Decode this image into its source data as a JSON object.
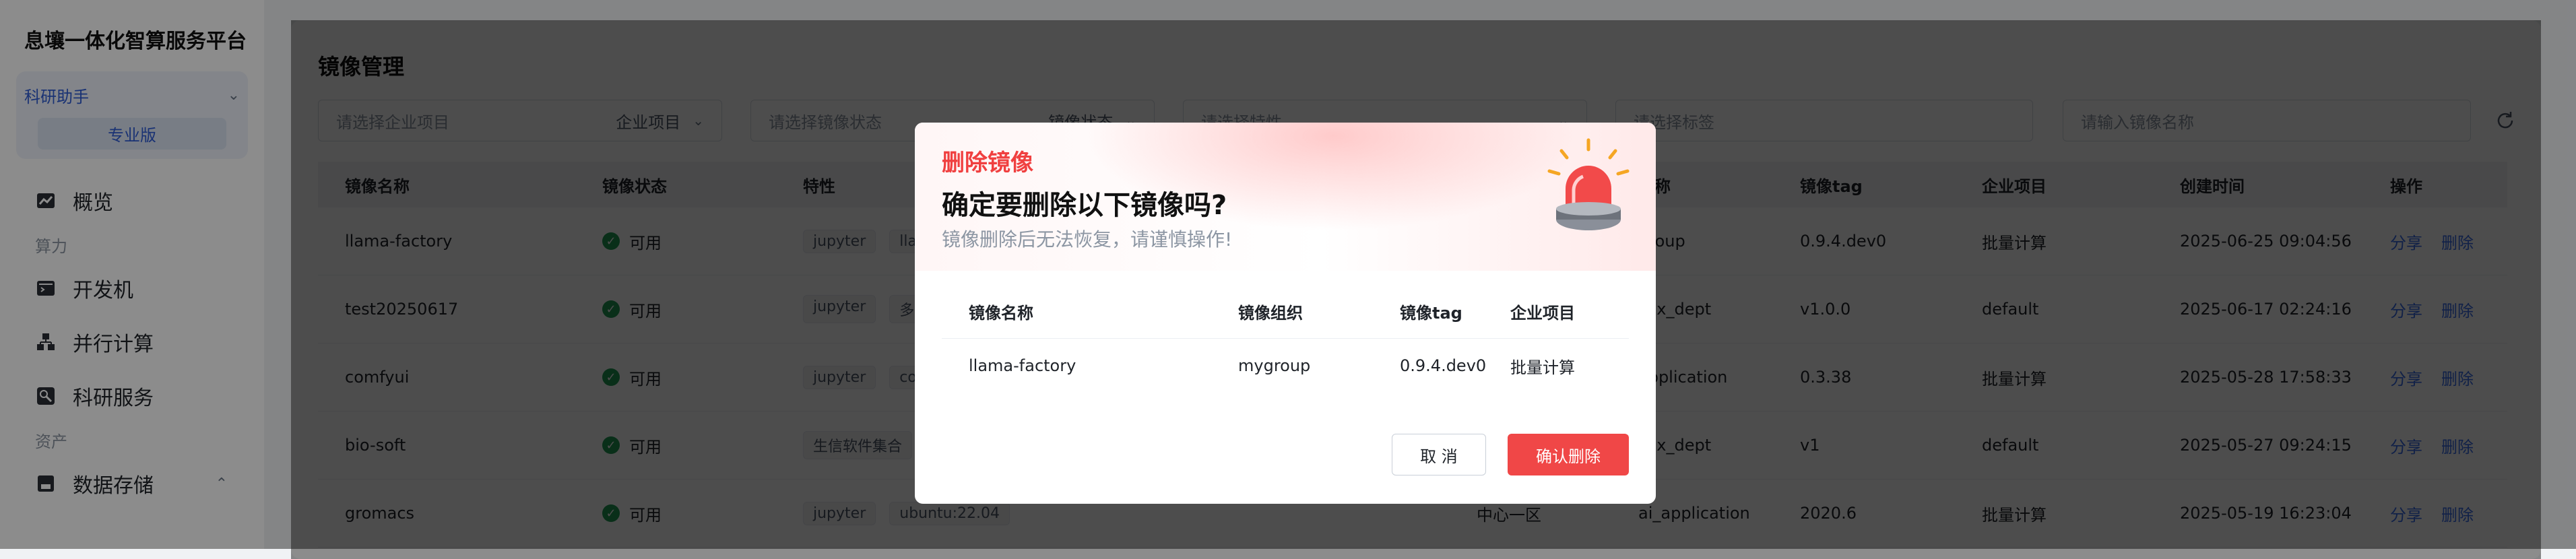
{
  "app_title": "息壤一体化智算服务平台",
  "workspace": {
    "name": "科研助手",
    "badge": "专业版"
  },
  "nav": {
    "overview": "概览",
    "section_compute": "算力",
    "dev_machine": "开发机",
    "parallel": "并行计算",
    "research": "科研服务",
    "section_assets": "资产",
    "storage": "数据存储"
  },
  "page": {
    "title": "镜像管理"
  },
  "filters": {
    "project_placeholder": "请选择企业项目",
    "project_tag": "企业项目",
    "status_placeholder": "请选择镜像状态",
    "status_tag": "镜像状态",
    "feature_placeholder": "请选择特性",
    "label_placeholder": "请选择标签",
    "name_placeholder": "请输入镜像名称"
  },
  "table": {
    "headers": [
      "镜像名称",
      "镜像状态",
      "特性",
      "",
      "名称",
      "镜像tag",
      "企业项目",
      "创建时间",
      "操作"
    ],
    "rows": [
      {
        "name": "llama-factory",
        "status": "可用",
        "chips": [
          "jupyter",
          "llam"
        ],
        "region": "",
        "org": "group",
        "tag": "0.9.4.dev0",
        "project": "批量计算",
        "created": "2025-06-25 09:04:56"
      },
      {
        "name": "test20250617",
        "status": "可用",
        "chips": [
          "jupyter",
          "多"
        ],
        "region": "",
        "org": "esx_dept",
        "tag": "v1.0.0",
        "project": "default",
        "created": "2025-06-17 02:24:16"
      },
      {
        "name": "comfyui",
        "status": "可用",
        "chips": [
          "jupyter",
          "co"
        ],
        "region": "",
        "org": "application",
        "tag": "0.3.38",
        "project": "批量计算",
        "created": "2025-05-28 17:58:33"
      },
      {
        "name": "bio-soft",
        "status": "可用",
        "chips": [
          "生信软件集合"
        ],
        "region": "",
        "org": "esx_dept",
        "tag": "v1",
        "project": "default",
        "created": "2025-05-27 09:24:15"
      },
      {
        "name": "gromacs",
        "status": "可用",
        "chips": [
          "jupyter",
          "ubuntu:22.04"
        ],
        "region": "中心一区",
        "org": "ai_application",
        "tag": "2020.6",
        "project": "批量计算",
        "created": "2025-05-19 16:23:04"
      }
    ],
    "share_label": "分享",
    "delete_label": "删除"
  },
  "modal": {
    "kicker": "删除镜像",
    "title": "确定要删除以下镜像吗?",
    "subtitle": "镜像删除后无法恢复，请谨慎操作!",
    "headers": [
      "镜像名称",
      "镜像组织",
      "镜像tag",
      "企业项目"
    ],
    "row": [
      "llama-factory",
      "mygroup",
      "0.9.4.dev0",
      "批量计算"
    ],
    "cancel": "取 消",
    "confirm": "确认删除"
  },
  "colors": {
    "accent": "#3a6ff0",
    "danger": "#f04747",
    "ok": "#1f9d55"
  }
}
